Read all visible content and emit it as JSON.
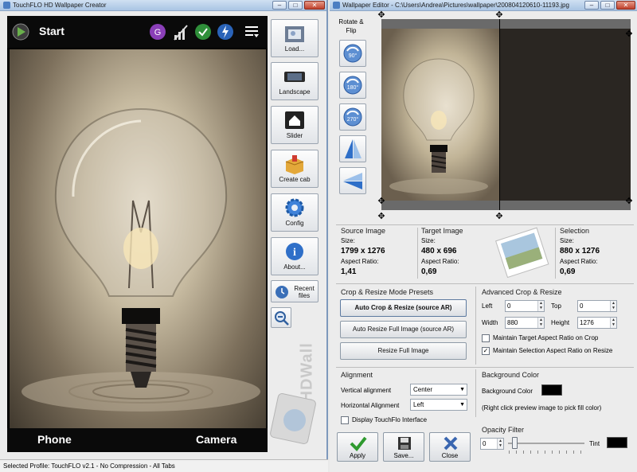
{
  "left_window": {
    "title": "TouchFLO HD Wallpaper Creator",
    "window_buttons": [
      "–",
      "□",
      "✕"
    ],
    "phone": {
      "start_label": "Start",
      "bottom_left": "Phone",
      "bottom_right": "Camera",
      "watermark": "HDWall"
    },
    "toolbar": {
      "load": "Load...",
      "landscape": "Landscape",
      "slider": "Slider",
      "create_cab": "Create cab",
      "config": "Config",
      "about": "About...",
      "recent_files": "Recent files"
    },
    "status_bar": "Selected Profile: TouchFLO v2.1 - No Compression - All Tabs"
  },
  "right_window": {
    "title": "Wallpaper Editor - C:\\Users\\Andrea\\Pictures\\wallpaper\\200804120610-11193.jpg",
    "window_buttons": [
      "–",
      "□",
      "✕"
    ],
    "rotate_flip": {
      "label": "Rotate & Flip",
      "buttons": [
        "90°",
        "180°",
        "270°",
        "",
        ""
      ]
    },
    "source_image": {
      "title": "Source Image",
      "size_label": "Size:",
      "size": "1799 x 1276",
      "ar_label": "Aspect Ratio:",
      "ar": "1,41"
    },
    "target_image": {
      "title": "Target Image",
      "size_label": "Size:",
      "size": "480 x 696",
      "ar_label": "Aspect Ratio:",
      "ar": "0,69"
    },
    "selection": {
      "title": "Selection",
      "size_label": "Size:",
      "size": "880 x 1276",
      "ar_label": "Aspect Ratio:",
      "ar": "0,69"
    },
    "presets": {
      "title": "Crop & Resize Mode Presets",
      "auto_crop": "Auto Crop & Resize (source AR)",
      "auto_resize": "Auto Resize Full Image (source AR)",
      "resize_full": "Resize Full Image"
    },
    "advanced": {
      "title": "Advanced Crop & Resize",
      "left_label": "Left",
      "left": "0",
      "top_label": "Top",
      "top": "0",
      "width_label": "Width",
      "width": "880",
      "height_label": "Height",
      "height": "1276",
      "maintain_target": "Maintain Target Aspect Ratio on Crop",
      "maintain_selection": "Maintain Selection Aspect Ratio on Resize"
    },
    "alignment": {
      "title": "Alignment",
      "vertical_label": "Vertical alignment",
      "vertical": "Center",
      "horizontal_label": "Horizontal Alignment",
      "horizontal": "Left",
      "display_touchflo": "Display TouchFlo Interface"
    },
    "background": {
      "title": "Background Color",
      "label": "Background Color",
      "hint": "(Right click preview image to pick fill color)",
      "color": "#000000"
    },
    "opacity": {
      "title": "Opacity Filter",
      "value": "0",
      "tint_label": "Tint",
      "tint_color": "#000000"
    },
    "actions": {
      "apply": "Apply",
      "save": "Save...",
      "close": "Close"
    }
  },
  "colors": {
    "titlebar": "#b6cde8",
    "panel": "#ececec",
    "apply_check": "#2f9a2f",
    "close_x": "#3a66b0"
  }
}
